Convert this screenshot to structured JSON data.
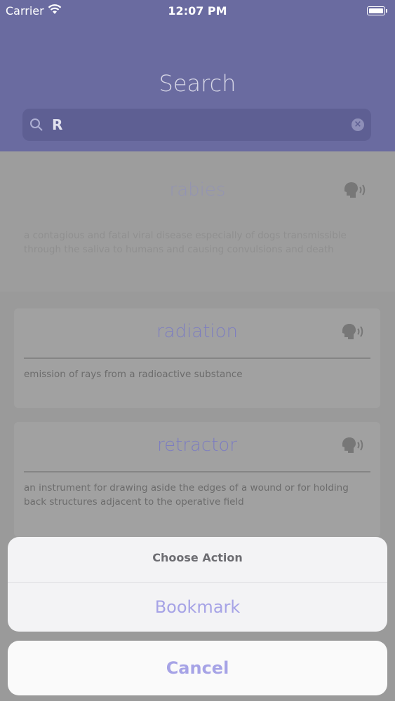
{
  "status_bar": {
    "carrier": "Carrier",
    "time": "12:07 PM"
  },
  "header": {
    "title": "Search",
    "search": {
      "value": "R",
      "placeholder": ""
    }
  },
  "results": [
    {
      "word": "rabies",
      "definition": "a contagious and fatal viral disease especially of dogs transmissible through the saliva to humans and causing convulsions and death"
    },
    {
      "word": "radiation",
      "definition": "emission of rays from a radioactive substance"
    },
    {
      "word": "retractor",
      "definition": "an instrument for drawing aside the edges of a wound or for holding back structures adjacent to the operative field"
    }
  ],
  "action_sheet": {
    "title": "Choose Action",
    "bookmark_label": "Bookmark",
    "cancel_label": "Cancel"
  },
  "colors": {
    "header": "#6a6ba0",
    "accent": "#a6a3e6",
    "word": "#7d7ec0"
  },
  "icons": [
    "wifi-icon",
    "battery-icon",
    "search-icon",
    "clear-icon",
    "speak-icon"
  ]
}
